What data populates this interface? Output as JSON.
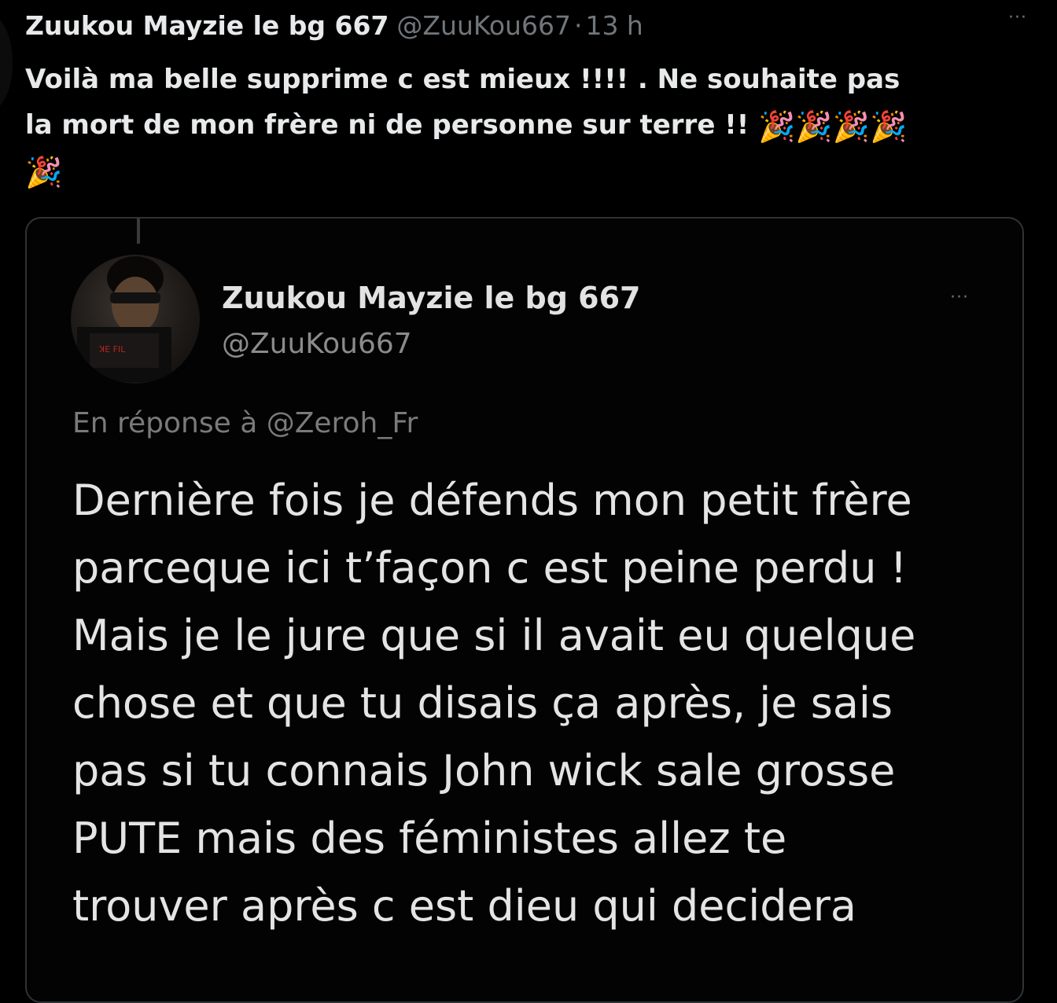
{
  "tweet": {
    "author_name": "Zuukou Mayzie le bg 667",
    "author_handle": "@ZuuKou667",
    "separator": "·",
    "timestamp": "13 h",
    "more_label": "···",
    "text_lines": [
      "Voilà ma belle supprime c est mieux !!!! . Ne souhaite pas",
      "la mort de mon frère ni de personne sur terre !! "
    ],
    "emoji": "🎉"
  },
  "quoted": {
    "author_name": "Zuukou Mayzie le bg 667",
    "author_handle": "@ZuuKou667",
    "more_label": "···",
    "reply_to": "En réponse à @Zeroh_Fr",
    "body_lines": [
      "Dernière fois je défends mon petit frère",
      "parceque ici t’façon c est peine perdu !",
      "Mais je le jure que si il avait eu quelque",
      "chose et que tu disais ça après, je sais",
      "pas si tu connais John wick sale grosse",
      "PUTE mais des féministes allez te",
      "trouver après c est dieu qui decidera"
    ]
  },
  "colors": {
    "background": "#000000",
    "primary_text": "#e7e9ea",
    "secondary_text": "#71767b",
    "card_border": "#2f3336"
  },
  "icons": {
    "party": "party-popper-icon",
    "more": "more-options-icon"
  }
}
